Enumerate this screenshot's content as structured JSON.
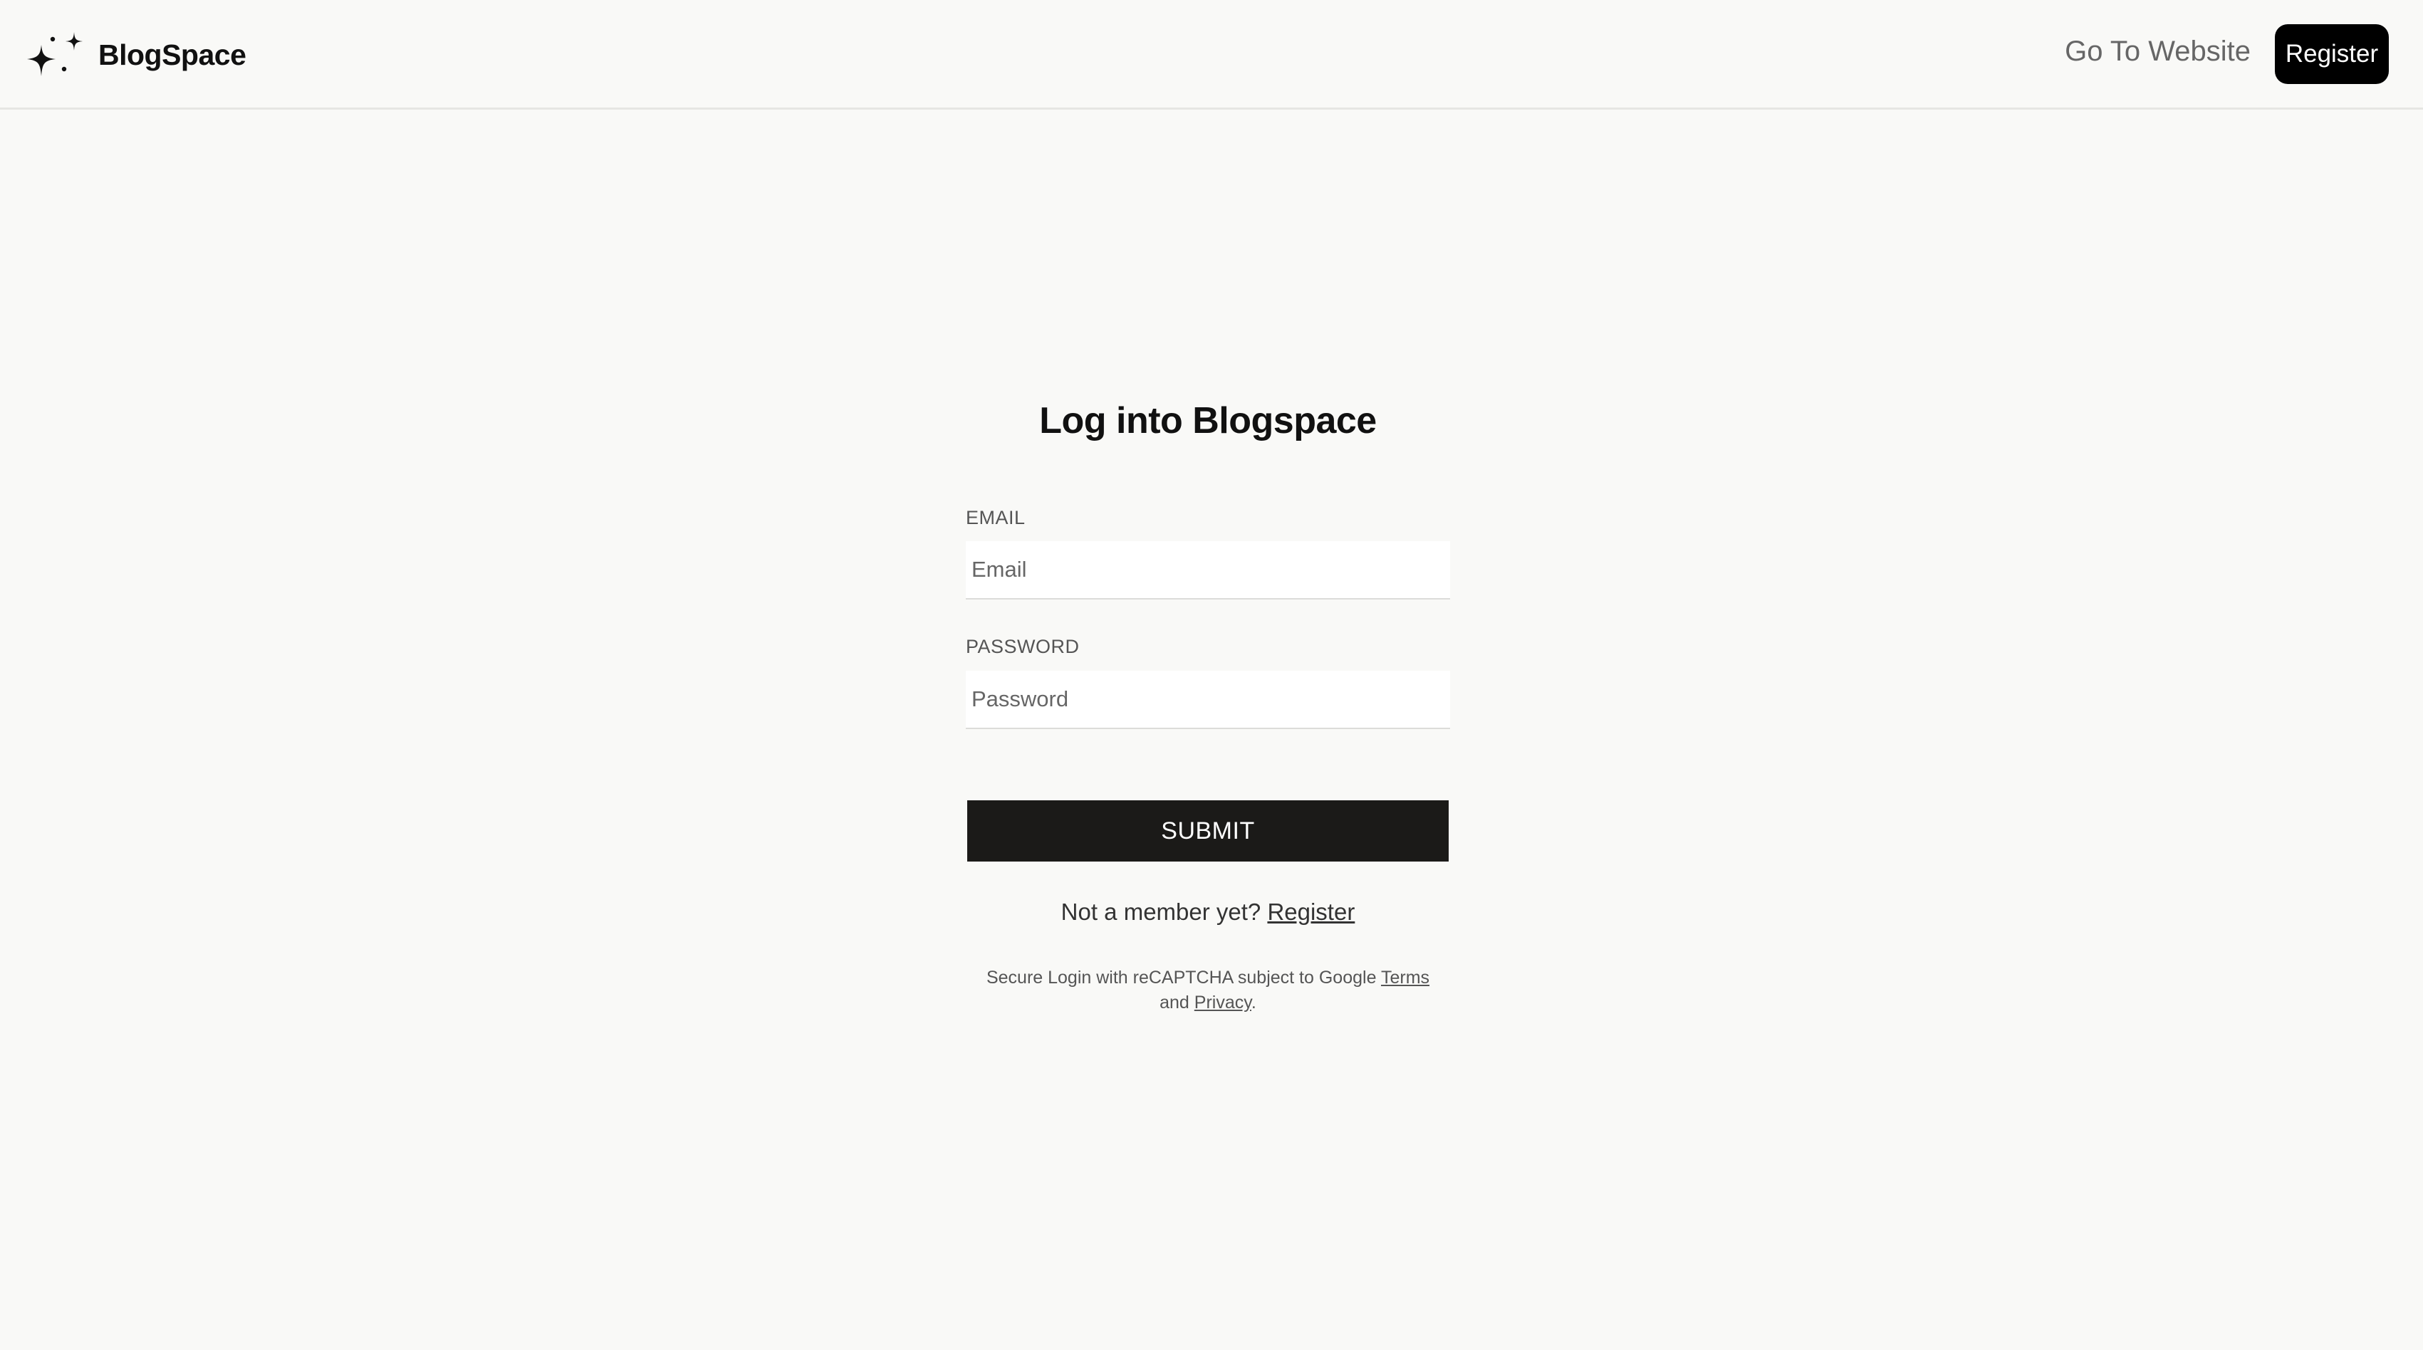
{
  "header": {
    "brand_name": "BlogSpace",
    "brand_icon": "sparkles-icon",
    "nav_link_label": "Go To Website",
    "register_label": "Register"
  },
  "login": {
    "title": "Log into Blogspace",
    "email_label": "EMAIL",
    "email_placeholder": "Email",
    "email_value": "",
    "password_label": "PASSWORD",
    "password_placeholder": "Password",
    "password_value": "",
    "submit_label": "SUBMIT",
    "member_prompt": "Not a member yet? ",
    "member_link": "Register",
    "recaptcha_prefix": "Secure Login with reCAPTCHA subject to Google ",
    "recaptcha_terms": "Terms",
    "recaptcha_and": "and ",
    "recaptcha_privacy": "Privacy",
    "recaptcha_suffix": "."
  },
  "colors": {
    "background": "#f9f9f7",
    "primary_button": "#1b1a18",
    "nav_button": "#000000",
    "text_muted": "#666666"
  }
}
